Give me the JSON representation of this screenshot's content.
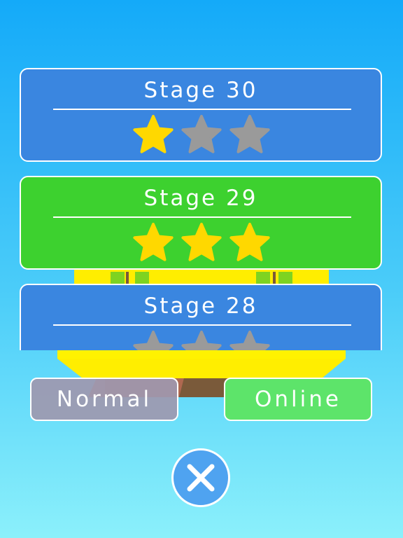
{
  "stages": [
    {
      "label": "Stage 30",
      "color": "blue",
      "stars_earned": 1,
      "stars_total": 3
    },
    {
      "label": "Stage 29",
      "color": "green",
      "stars_earned": 3,
      "stars_total": 3
    },
    {
      "label": "Stage 28",
      "color": "blue",
      "stars_earned": 0,
      "stars_total": 3
    }
  ],
  "buttons": {
    "normal_label": "Normal",
    "online_label": "Online"
  },
  "colors": {
    "star_filled": "#ffd800",
    "star_empty": "#9a9a9a",
    "card_blue": "#3a86e0",
    "card_green": "#3dd12f",
    "island_yellow": "#ffee00",
    "island_dirt": "#7a5a3a"
  },
  "icons": {
    "close": "close-icon",
    "star": "star-icon"
  }
}
